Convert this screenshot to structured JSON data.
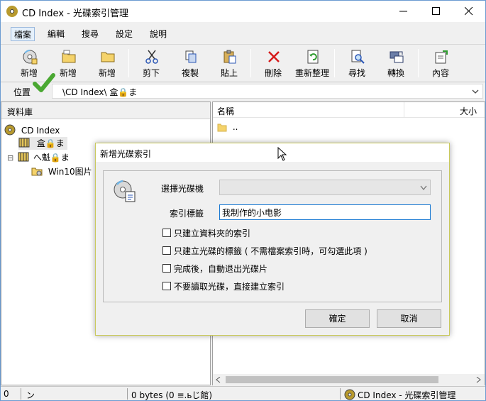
{
  "window": {
    "title": "CD Index - 光碟索引管理"
  },
  "menu": [
    "檔案",
    "編輯",
    "搜尋",
    "設定",
    "說明"
  ],
  "toolbar": [
    {
      "label": "新增",
      "icon": "disc-add-icon"
    },
    {
      "label": "新增",
      "icon": "folder-add-icon"
    },
    {
      "label": "新增",
      "icon": "folder-icon"
    },
    {
      "label": "剪下",
      "icon": "scissors-icon"
    },
    {
      "label": "複製",
      "icon": "copy-icon"
    },
    {
      "label": "貼上",
      "icon": "paste-icon"
    },
    {
      "label": "刪除",
      "icon": "delete-x-icon"
    },
    {
      "label": "重新整理",
      "icon": "refresh-icon"
    },
    {
      "label": "尋找",
      "icon": "find-icon"
    },
    {
      "label": "轉換",
      "icon": "convert-icon"
    },
    {
      "label": "內容",
      "icon": "properties-icon"
    }
  ],
  "location": {
    "label": "位置",
    "path": "\\CD Index\\ 盒🔒ま"
  },
  "left_pane": {
    "header": "資料庫",
    "tree": [
      {
        "label": "CD Index",
        "icon": "cd-index-icon",
        "level": 0
      },
      {
        "label": "盒🔒ま",
        "icon": "film-box-icon",
        "level": 1
      },
      {
        "label": "へ魁🔒ま",
        "icon": "film-box-icon",
        "level": 0,
        "expander": "⊟"
      },
      {
        "label": "Win10图片",
        "icon": "disc-folder-icon",
        "level": 2
      }
    ]
  },
  "right_pane": {
    "columns": [
      "名稱",
      "大小"
    ],
    "rows": [
      {
        "name": ".."
      }
    ]
  },
  "status": {
    "left": "0",
    "mid": "ン",
    "right": "0 bytes (0 ≡.ьじ館)",
    "app": "CD Index - 光碟索引管理"
  },
  "dialog": {
    "title": "新增光碟索引",
    "drive_label": "選擇光碟機",
    "drive_value": "",
    "index_label": "索引標籤",
    "index_value": "我制作的小电影",
    "checkboxes": [
      {
        "label": "只建立資料夾的索引",
        "checked": false
      },
      {
        "label": "只建立光碟的標籤 ( 不需檔案索引時，可勾選此項 )",
        "checked": false
      },
      {
        "label": "完成後，自動退出光碟片",
        "checked": false
      },
      {
        "label": "不要讀取光碟，直接建立索引",
        "checked": false
      }
    ],
    "ok": "確定",
    "cancel": "取消"
  },
  "colors": {
    "accent": "#1c7bd3",
    "check_mark": "#4aa832",
    "folder": "#f5d36b"
  }
}
